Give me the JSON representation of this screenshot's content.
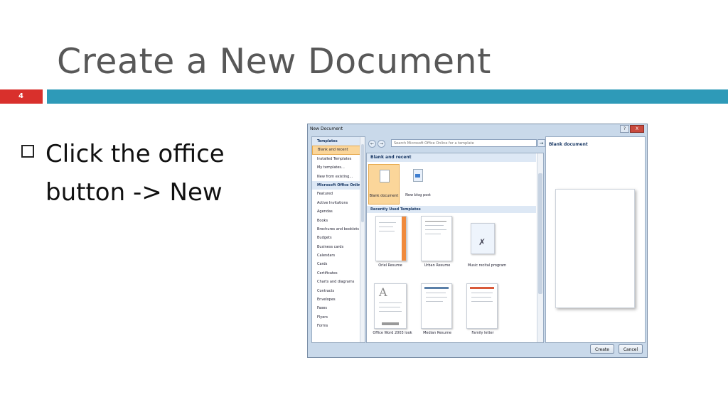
{
  "slide": {
    "title": "Create a New Document",
    "number": "4",
    "bullet": "Click the office button -> New"
  },
  "colors": {
    "accent_red": "#d9302c",
    "accent_blue": "#2e9ab8",
    "title_gray": "#585858"
  },
  "dialog": {
    "title": "New Document",
    "window_buttons": {
      "help": "?",
      "close": "X"
    },
    "templates_header": "Templates",
    "categories": [
      "Blank and recent",
      "Installed Templates",
      "My templates...",
      "New from existing...",
      "Microsoft Office Online",
      "Featured",
      "Active Invitations",
      "Agendas",
      "Books",
      "Brochures and booklets",
      "Budgets",
      "Business cards",
      "Calendars",
      "Cards",
      "Certificates",
      "Charts and diagrams",
      "Contracts",
      "Envelopes",
      "Faxes",
      "Flyers",
      "Forms"
    ],
    "search_placeholder": "Search Microsoft Office Online for a template",
    "section_blank": "Blank and recent",
    "blank_items": [
      "Blank document",
      "New blog post"
    ],
    "section_recent": "Recently Used Templates",
    "recent_templates": [
      "Oriel Resume",
      "Urban Resume",
      "Music recital program",
      "Office Word 2003 look",
      "Median Resume",
      "Family letter"
    ],
    "preview_title": "Blank document",
    "create_label": "Create",
    "cancel_label": "Cancel"
  }
}
